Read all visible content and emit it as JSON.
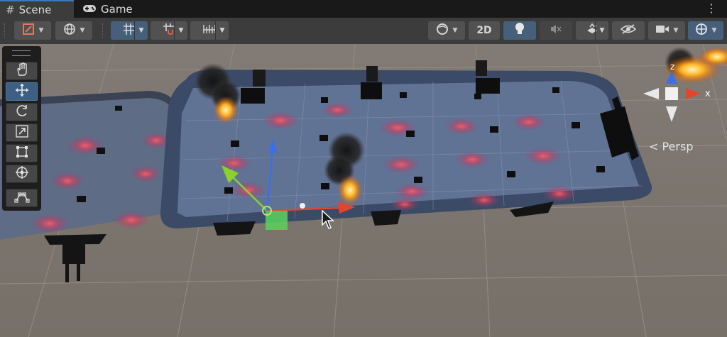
{
  "tabs": [
    {
      "label": "Scene",
      "icon": "hash-icon",
      "active": true
    },
    {
      "label": "Game",
      "icon": "gamepad-icon",
      "active": false
    }
  ],
  "toolbar": {
    "draw_mode_icon": "shading-mode-icon",
    "global_icon": "globe-icon",
    "grid_snap_icon": "grid-snap-icon",
    "increment_snap_icon": "increment-snap-icon",
    "ruler_icon": "ruler-icon",
    "render_icon": "sphere-icon",
    "mode_2d_label": "2D",
    "lighting_icon": "lightbulb-icon",
    "audio_icon": "audio-mute-icon",
    "effects_icon": "effects-icon",
    "hidden_icon": "visibility-icon",
    "camera_icon": "camera-icon",
    "gizmos_icon": "gizmos-icon"
  },
  "tool_palette": [
    {
      "name": "hand-tool",
      "icon": "hand-icon"
    },
    {
      "name": "move-tool",
      "icon": "move-arrows-icon",
      "selected": true
    },
    {
      "name": "rotate-tool",
      "icon": "rotate-icon"
    },
    {
      "name": "scale-tool",
      "icon": "scale-icon"
    },
    {
      "name": "rect-tool",
      "icon": "rect-transform-icon"
    },
    {
      "name": "transform-tool",
      "icon": "transform-icon"
    },
    {
      "name": "custom-tool",
      "icon": "custom-editor-tool-icon"
    }
  ],
  "orientation_gizmo": {
    "y_label": "z",
    "x_label": "x",
    "projection_label": "Persp"
  },
  "colors": {
    "accent": "#3a79bb",
    "toolbar": "#3c3c3c",
    "selected": "#46607c",
    "x_axis": "#e2452e",
    "y_axis": "#8ad12e",
    "z_axis": "#3a6fe6"
  }
}
